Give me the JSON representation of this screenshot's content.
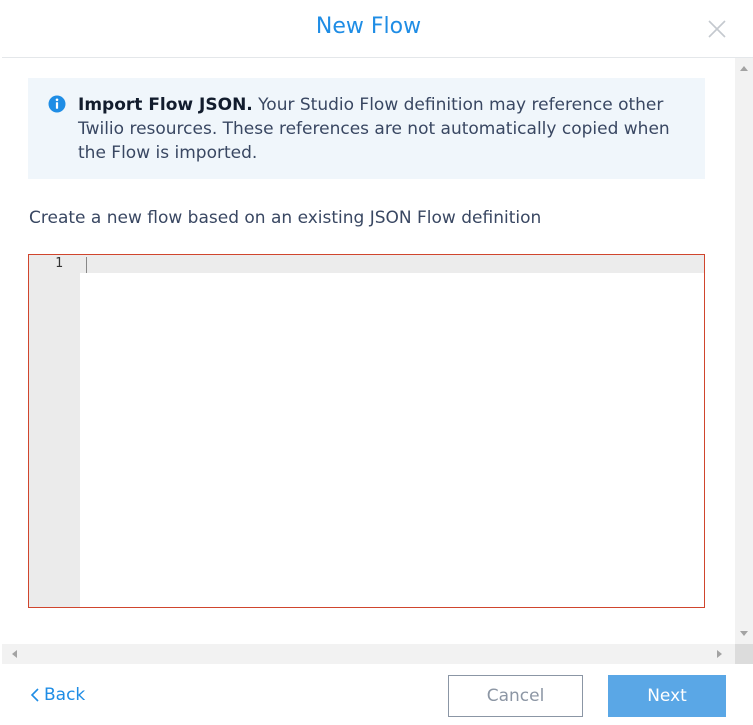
{
  "dialog": {
    "title": "New Flow"
  },
  "info": {
    "heading": "Import Flow JSON.",
    "message": " Your Studio Flow definition may reference other Twilio resources. These references are not automatically copied when the Flow is imported."
  },
  "description": "Create a new flow based on an existing JSON Flow definition",
  "editor": {
    "line_numbers": [
      "1"
    ],
    "content": "",
    "border_color": "#d0452d"
  },
  "footer": {
    "back_label": "Back",
    "cancel_label": "Cancel",
    "next_label": "Next"
  },
  "colors": {
    "accent": "#1f8de5",
    "primary_button": "#5aa7e6",
    "info_background": "#f0f6fb"
  },
  "icons": {
    "close": "close-icon",
    "info": "info-icon",
    "back": "chevron-left-icon"
  }
}
